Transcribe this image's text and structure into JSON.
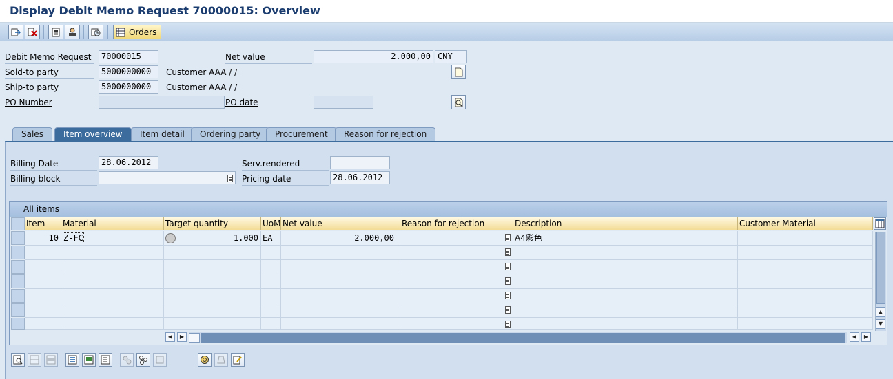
{
  "title": "Display Debit Memo Request 70000015: Overview",
  "toolbar": {
    "orders_label": "Orders",
    "buttons": [
      "change-display-icon",
      "cancel-icon",
      "header-doc-icon",
      "partner-icon",
      "display-doc-flow-icon"
    ]
  },
  "header": {
    "debit_memo_request_label": "Debit Memo Request",
    "debit_memo_request_value": "70000015",
    "net_value_label": "Net value",
    "net_value": "2.000,00",
    "currency": "CNY",
    "sold_to_label": "Sold-to party",
    "sold_to_value": "5000000000",
    "sold_to_name": "Customer AAA / /",
    "ship_to_label": "Ship-to party",
    "ship_to_value": "5000000000",
    "ship_to_name": "Customer AAA / /",
    "po_number_label": "PO Number",
    "po_number_value": "",
    "po_date_label": "PO date",
    "po_date_value": ""
  },
  "tabs": [
    "Sales",
    "Item overview",
    "Item detail",
    "Ordering party",
    "Procurement",
    "Reason for rejection"
  ],
  "active_tab": "Item overview",
  "item_overview": {
    "billing_date_label": "Billing Date",
    "billing_date_value": "28.06.2012",
    "billing_block_label": "Billing block",
    "billing_block_value": "",
    "serv_rendered_label": "Serv.rendered",
    "serv_rendered_value": "",
    "pricing_date_label": "Pricing date",
    "pricing_date_value": "28.06.2012"
  },
  "grid": {
    "title": "All items",
    "columns": [
      "Item",
      "Material",
      "Target quantity",
      "UoM",
      "Net value",
      "Reason for rejection",
      "Description",
      "Customer Material"
    ],
    "rows": [
      {
        "item": "10",
        "material": "Z-FC",
        "target_quantity": "1.000",
        "uom": "EA",
        "net_value": "2.000,00",
        "reason": "",
        "description": "A4彩色",
        "customer_material": ""
      }
    ]
  },
  "colors": {
    "accent": "#3c6c9d",
    "panel": "#d2dfee",
    "header_col": "#f3dc95"
  }
}
